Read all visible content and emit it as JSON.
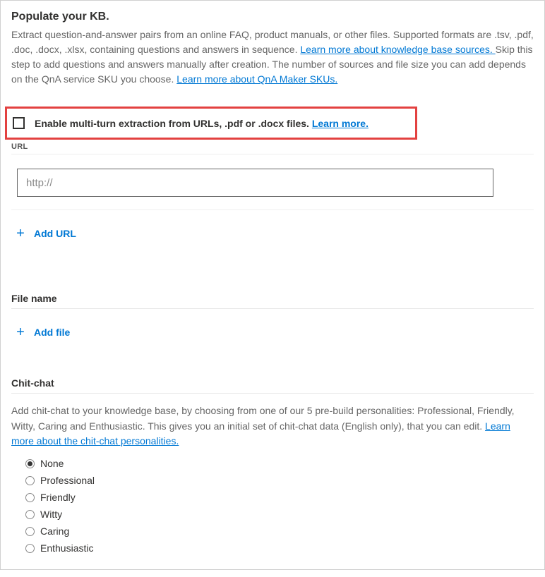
{
  "header": {
    "title": "Populate your KB.",
    "desc_part1": "Extract question-and-answer pairs from an online FAQ, product manuals, or other files. Supported formats are .tsv, .pdf, .doc, .docx, .xlsx, containing questions and answers in sequence. ",
    "link1": "Learn more about knowledge base sources. ",
    "desc_part2": "Skip this step to add questions and answers manually after creation. The number of sources and file size you can add depends on the QnA service SKU you choose. ",
    "link2": "Learn more about QnA Maker SKUs."
  },
  "multiturn": {
    "label_prefix": "Enable multi-turn extraction from URLs, .pdf or .docx files. ",
    "learn_more": "Learn more."
  },
  "url_section": {
    "label": "URL",
    "placeholder": "http://",
    "add_label": "Add URL"
  },
  "file_section": {
    "label": "File name",
    "add_label": "Add file"
  },
  "chitchat": {
    "title": "Chit-chat",
    "desc_part1": "Add chit-chat to your knowledge base, by choosing from one of our 5 pre-build personalities: Professional, Friendly, Witty, Caring and Enthusiastic. This gives you an initial set of chit-chat data (English only), that you can edit. ",
    "learn_more": "Learn more about the chit-chat personalities.",
    "options": [
      "None",
      "Professional",
      "Friendly",
      "Witty",
      "Caring",
      "Enthusiastic"
    ],
    "selected_index": 0
  }
}
